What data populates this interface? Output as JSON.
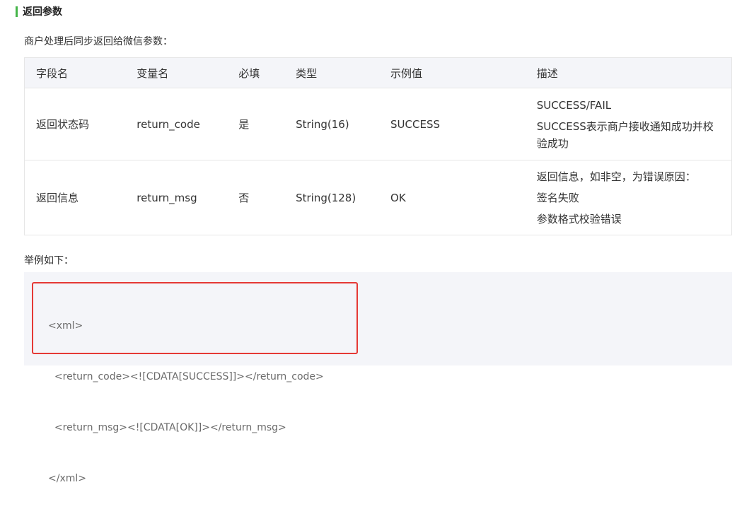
{
  "section": {
    "title": "返回参数",
    "accent_color": "#44b549"
  },
  "intro": "商户处理后同步返回给微信参数：",
  "table": {
    "headers": [
      "字段名",
      "变量名",
      "必填",
      "类型",
      "示例值",
      "描述"
    ],
    "rows": [
      {
        "field": "返回状态码",
        "variable": "return_code",
        "required": "是",
        "type": "String(16)",
        "example": "SUCCESS",
        "desc": [
          "SUCCESS/FAIL",
          "SUCCESS表示商户接收通知成功并校",
          "验成功"
        ]
      },
      {
        "field": "返回信息",
        "variable": "return_msg",
        "required": "否",
        "type": "String(128)",
        "example": "OK",
        "desc": [
          "返回信息，如非空，为错误原因：",
          "签名失败",
          "参数格式校验错误"
        ]
      }
    ]
  },
  "example_label": "举例如下：",
  "code": {
    "lines": [
      "<xml>",
      "  <return_code><![CDATA[SUCCESS]]></return_code>",
      "  <return_msg><![CDATA[OK]]></return_msg>",
      "</xml>"
    ],
    "highlight_color": "#e53935"
  }
}
